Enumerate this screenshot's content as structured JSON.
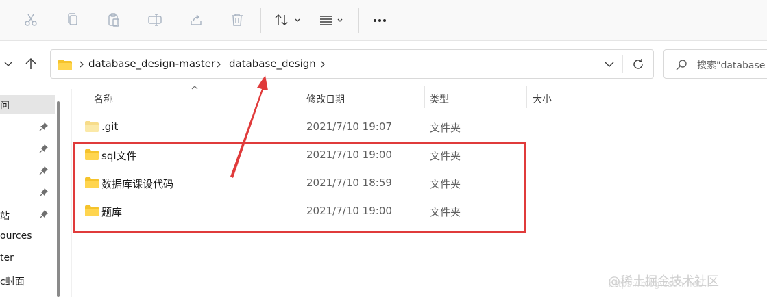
{
  "colors": {
    "accent_red": "#e03b3b",
    "folder_yellow": "#f5c32c",
    "selected_bg": "#e5e5e5"
  },
  "toolbar": {
    "icons": [
      "cut-icon",
      "copy-icon",
      "paste-icon",
      "rename-icon",
      "share-icon",
      "delete-icon",
      "sort-icon",
      "view-icon",
      "more-icon"
    ]
  },
  "address": {
    "crumbs": [
      "database_design-master",
      "database_design"
    ]
  },
  "search": {
    "placeholder": "搜索\"database"
  },
  "sidebar": {
    "items": [
      {
        "label": "问",
        "pinned": false
      },
      {
        "label": "",
        "pinned": true
      },
      {
        "label": "",
        "pinned": true
      },
      {
        "label": "",
        "pinned": true
      },
      {
        "label": "",
        "pinned": true
      },
      {
        "label": "站",
        "pinned": true
      },
      {
        "label": "ources",
        "pinned": false
      },
      {
        "label": "ter",
        "pinned": false
      },
      {
        "label": "c封面",
        "pinned": false
      }
    ]
  },
  "columns": {
    "name": "名称",
    "date": "修改日期",
    "type": "类型",
    "size": "大小"
  },
  "files": [
    {
      "name": ".git",
      "date": "2021/7/10 19:07",
      "type": "文件夹",
      "icon": "folder-light-icon"
    },
    {
      "name": "sql文件",
      "date": "2021/7/10 19:00",
      "type": "文件夹",
      "icon": "folder-icon"
    },
    {
      "name": "数据库课设代码",
      "date": "2021/7/10 18:59",
      "type": "文件夹",
      "icon": "folder-icon"
    },
    {
      "name": "题库",
      "date": "2021/7/10 19:00",
      "type": "文件夹",
      "icon": "folder-icon"
    }
  ],
  "watermark": {
    "text": "@稀土掘金技术社区",
    "url_fragment": "https://blog.csdn.net/..."
  }
}
